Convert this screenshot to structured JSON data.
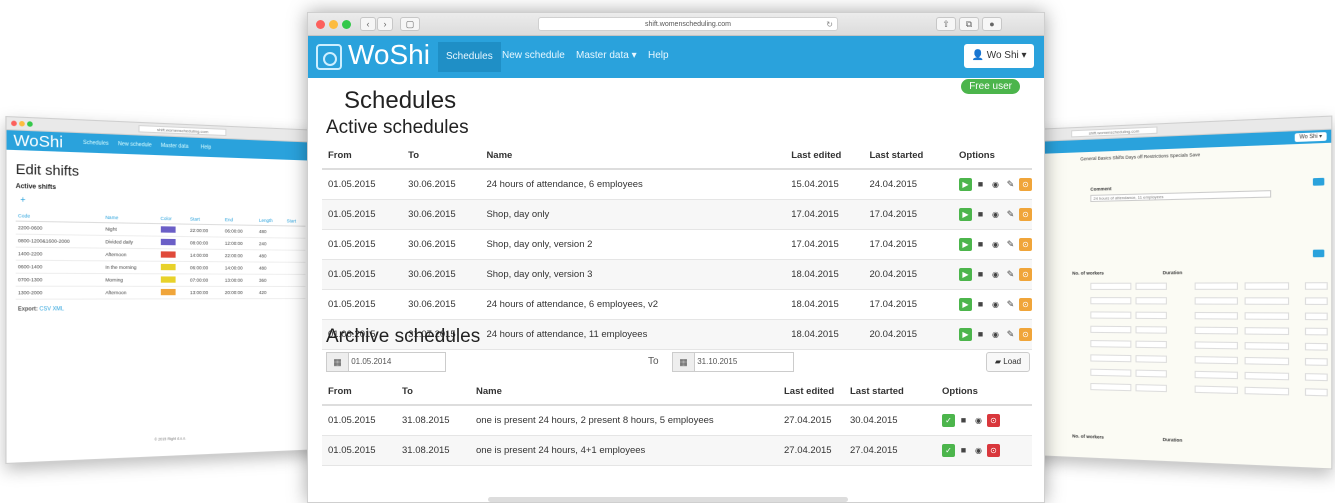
{
  "left_window": {
    "url": "shift.womenscheduling.com",
    "brand": "WoShi",
    "nav": [
      "Schedules",
      "New schedule",
      "Master data",
      "Help"
    ],
    "title": "Edit shifts",
    "subtitle": "Active shifts",
    "plus": "+",
    "columns": [
      "Code",
      "Name",
      "Color",
      "Start",
      "End",
      "Length",
      "Start"
    ],
    "rows": [
      {
        "code": "2200-0600",
        "name": "Night",
        "color": "#6b5fc7",
        "start": "22:00:00",
        "end": "06:00:00",
        "length": "480"
      },
      {
        "code": "0800-1200&1600-2000",
        "name": "Divided daily",
        "color": "#6b5fc7",
        "start": "08:00:00",
        "end": "12:00:00",
        "length": "240"
      },
      {
        "code": "1400-2200",
        "name": "Afternoon",
        "color": "#e04a3a",
        "start": "14:00:00",
        "end": "22:00:00",
        "length": "480"
      },
      {
        "code": "0600-1400",
        "name": "In the morning",
        "color": "#e8d22a",
        "start": "06:00:00",
        "end": "14:00:00",
        "length": "480"
      },
      {
        "code": "0700-1300",
        "name": "Morning",
        "color": "#e8d22a",
        "start": "07:00:00",
        "end": "13:00:00",
        "length": "360"
      },
      {
        "code": "1300-2000",
        "name": "Afternoon",
        "color": "#f0a53a",
        "start": "13:00:00",
        "end": "20:00:00",
        "length": "420"
      }
    ],
    "export_label": "Export:",
    "export_csv": "CSV",
    "export_xml": "XML",
    "footer": "© 2015 Right d.o.o."
  },
  "right_window": {
    "url": "shift.womenscheduling.com",
    "tabs": "General  Basics  Shifts  Days off  Restrictions  Specials  Save",
    "comment_label": "Comment",
    "comment_value": "24 hours of attendance, 11 employees",
    "workers_label": "No. of workers",
    "duration_label": "Duration",
    "workers_label_2": "No. of workers",
    "duration_label_2": "Duration"
  },
  "browser": {
    "url": "shift.womenscheduling.com"
  },
  "navbar": {
    "brand": "WoShi",
    "items": [
      "Schedules",
      "New schedule",
      "Master data ▾",
      "Help"
    ],
    "user": "Wo Shi ▾"
  },
  "badge": "Free user",
  "page_title": "Schedules",
  "active": {
    "title": "Active schedules",
    "headers": [
      "From",
      "To",
      "Name",
      "Last edited",
      "Last started",
      "Options"
    ],
    "rows": [
      {
        "from": "01.05.2015",
        "to": "30.06.2015",
        "name": "24 hours of attendance, 6 employees",
        "edited": "15.04.2015",
        "started": "24.04.2015"
      },
      {
        "from": "01.05.2015",
        "to": "30.06.2015",
        "name": "Shop, day only",
        "edited": "17.04.2015",
        "started": "17.04.2015"
      },
      {
        "from": "01.05.2015",
        "to": "30.06.2015",
        "name": "Shop, day only, version 2",
        "edited": "17.04.2015",
        "started": "17.04.2015"
      },
      {
        "from": "01.05.2015",
        "to": "30.06.2015",
        "name": "Shop, day only, version 3",
        "edited": "18.04.2015",
        "started": "20.04.2015"
      },
      {
        "from": "01.05.2015",
        "to": "30.06.2015",
        "name": "24 hours of attendance, 6 employees, v2",
        "edited": "18.04.2015",
        "started": "17.04.2015"
      },
      {
        "from": "01.06.2015",
        "to": "31.07.2015",
        "name": "24 hours of attendance, 11 employees",
        "edited": "18.04.2015",
        "started": "20.04.2015"
      }
    ]
  },
  "archive": {
    "title": "Archive schedules",
    "from_date": "01.05.2014",
    "to_label": "To",
    "to_date": "31.10.2015",
    "load": "Load",
    "headers": [
      "From",
      "To",
      "Name",
      "Last edited",
      "Last started",
      "Options"
    ],
    "rows": [
      {
        "from": "01.05.2015",
        "to": "31.08.2015",
        "name": "one is present 24 hours, 2 present 8 hours, 5 employees",
        "edited": "27.04.2015",
        "started": "30.04.2015"
      },
      {
        "from": "01.05.2015",
        "to": "31.08.2015",
        "name": "one is present 24 hours, 4+1 employees",
        "edited": "27.04.2015",
        "started": "27.04.2015"
      }
    ]
  }
}
